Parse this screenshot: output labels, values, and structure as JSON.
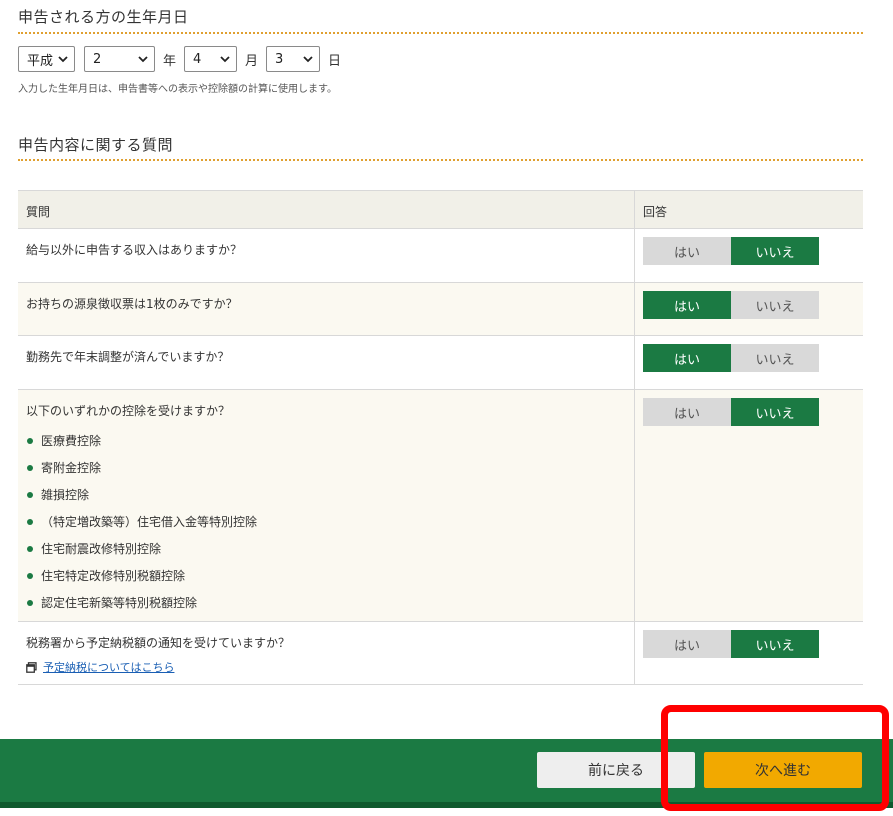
{
  "dob": {
    "title": "申告される方の生年月日",
    "era": "平成",
    "year": "2",
    "year_unit": "年",
    "month": "4",
    "month_unit": "月",
    "day": "3",
    "day_unit": "日",
    "note": "入力した生年月日は、申告書等への表示や控除額の計算に使用します。"
  },
  "questions": {
    "title": "申告内容に関する質問",
    "header_question": "質問",
    "header_answer": "回答",
    "yes_label": "はい",
    "no_label": "いいえ",
    "rows": [
      {
        "text": "給与以外に申告する収入はありますか？",
        "answer": "いいえ"
      },
      {
        "text": "お持ちの源泉徴収票は1枚のみですか？",
        "answer": "はい"
      },
      {
        "text": "勤務先で年末調整が済んでいますか？",
        "answer": "はい"
      },
      {
        "text": "以下のいずれかの控除を受けますか？",
        "answer": "いいえ",
        "items": [
          "医療費控除",
          "寄附金控除",
          "雑損控除",
          "（特定増改築等）住宅借入金等特別控除",
          "住宅耐震改修特別控除",
          "住宅特定改修特別税額控除",
          "認定住宅新築等特別税額控除"
        ]
      },
      {
        "text": "税務署から予定納税額の通知を受けていますか？",
        "answer": "いいえ",
        "link": "予定納税についてはこちら"
      }
    ]
  },
  "footer": {
    "back_label": "前に戻る",
    "next_label": "次へ進む"
  },
  "colors": {
    "accent_green": "#1b7a43",
    "next_button": "#f2a900",
    "highlight": "#ff0000"
  }
}
